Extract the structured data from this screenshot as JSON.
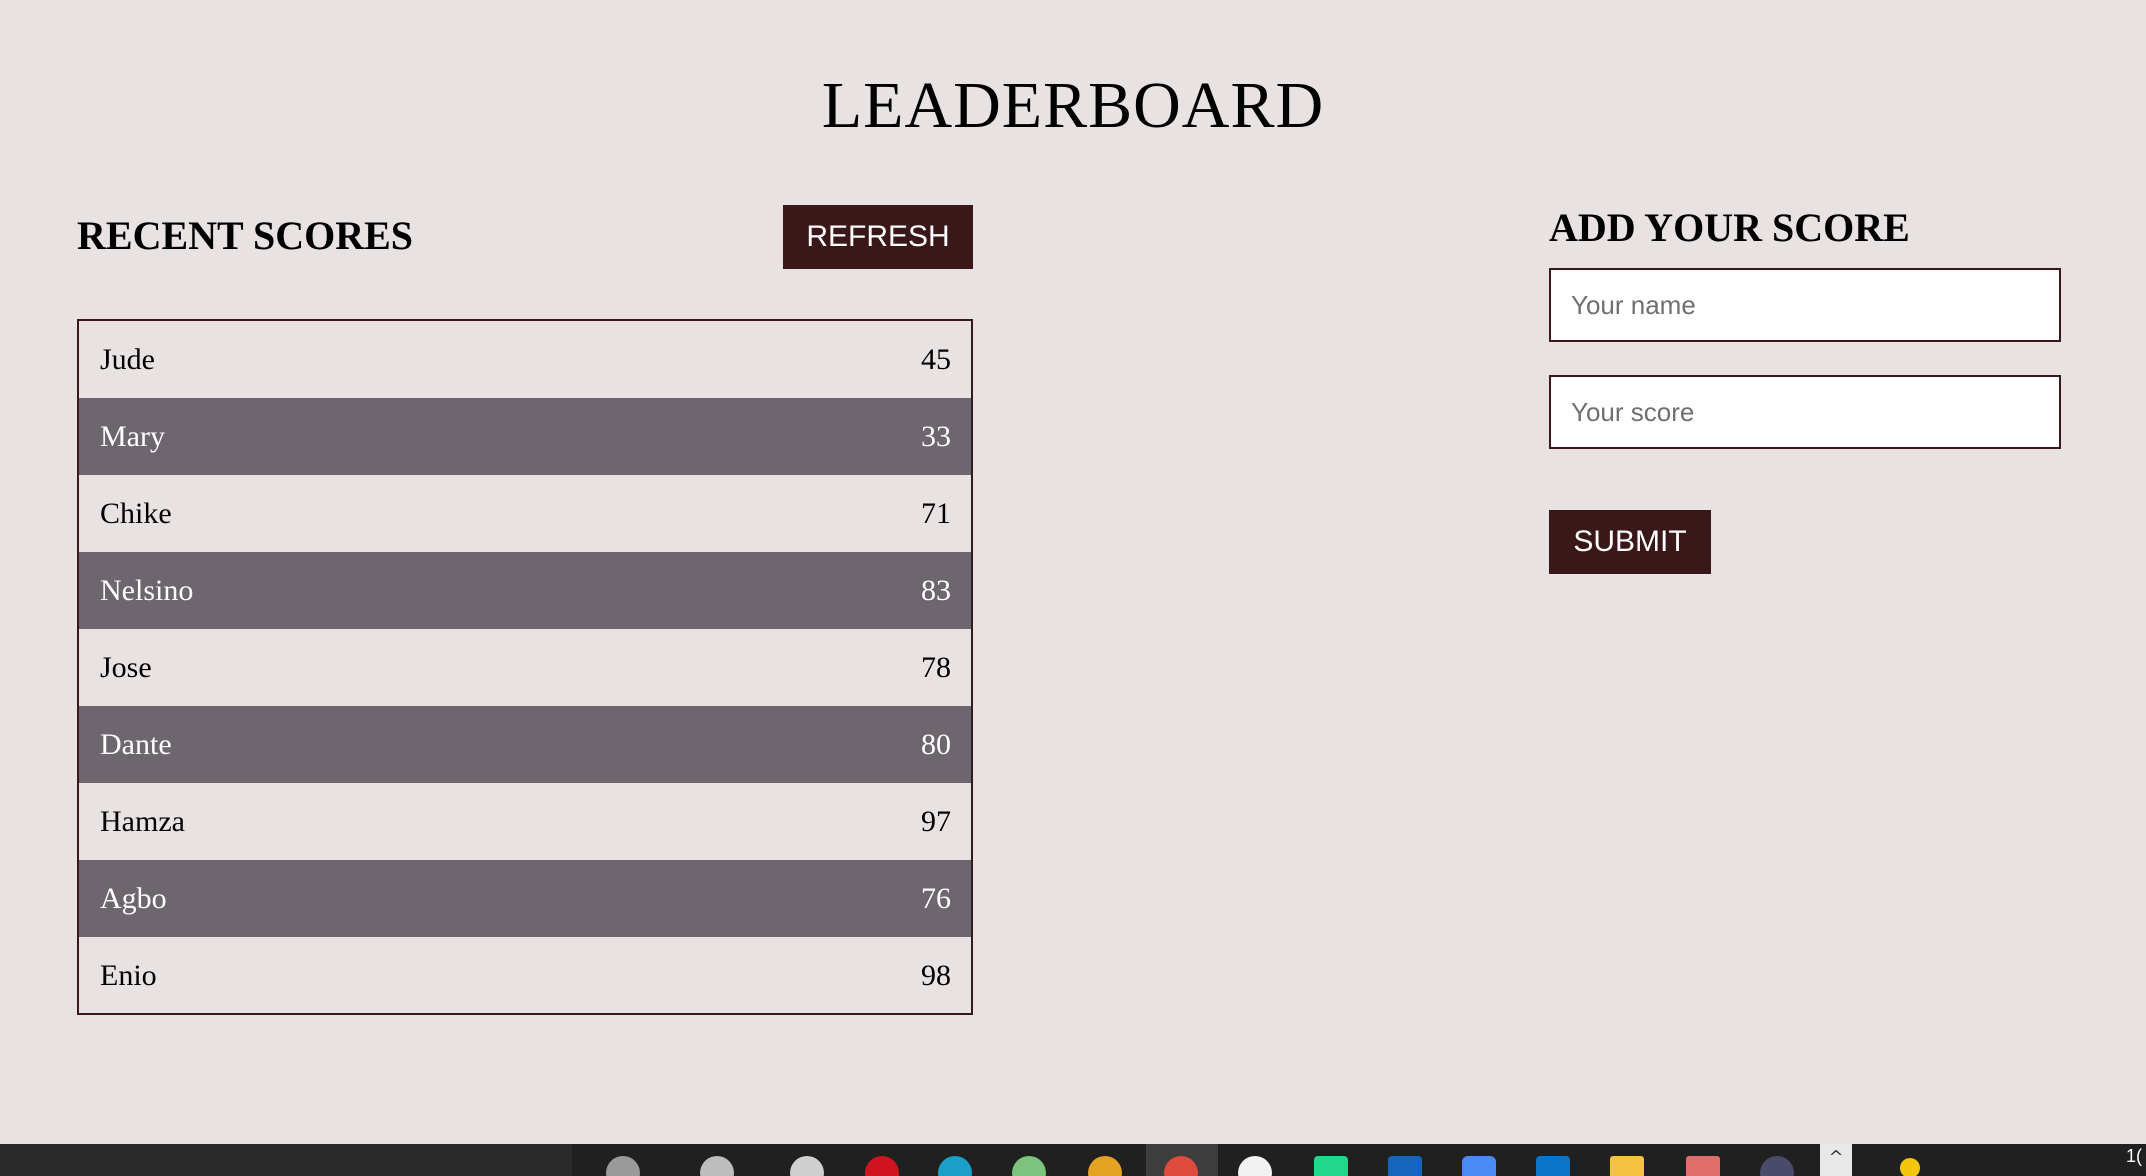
{
  "header": {
    "title": "LEADERBOARD"
  },
  "recent": {
    "heading": "RECENT SCORES",
    "refresh_label": "REFRESH",
    "scores": [
      {
        "name": "Jude",
        "score": "45"
      },
      {
        "name": "Mary",
        "score": "33"
      },
      {
        "name": "Chike",
        "score": "71"
      },
      {
        "name": "Nelsino",
        "score": "83"
      },
      {
        "name": "Jose",
        "score": "78"
      },
      {
        "name": "Dante",
        "score": "80"
      },
      {
        "name": "Hamza",
        "score": "97"
      },
      {
        "name": "Agbo",
        "score": "76"
      },
      {
        "name": "Enio",
        "score": "98"
      }
    ]
  },
  "form": {
    "heading": "ADD YOUR SCORE",
    "name_placeholder": "Your name",
    "name_value": "",
    "score_placeholder": "Your score",
    "score_value": "",
    "submit_label": "SUBMIT"
  },
  "taskbar": {
    "chevron_glyph": "^",
    "clock_text": "1("
  },
  "colors": {
    "background": "#e8e2e2",
    "accent": "#3a1719",
    "alt_row": "#6e666e",
    "taskbar": "#202020"
  }
}
